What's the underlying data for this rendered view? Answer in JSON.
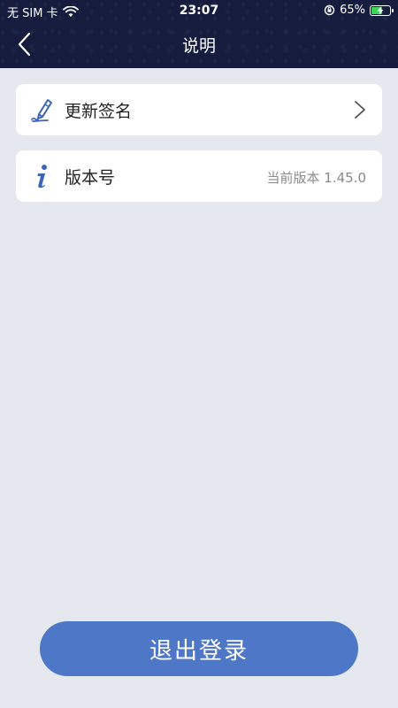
{
  "status_bar": {
    "carrier": "无 SIM 卡",
    "time": "23:07",
    "battery_percent": "65%",
    "battery_level": 0.65
  },
  "nav": {
    "title": "说明"
  },
  "items": [
    {
      "label": "更新签名",
      "icon": "signature-pen-icon",
      "has_chevron": true
    },
    {
      "label": "版本号",
      "icon": "info-icon",
      "value": "当前版本 1.45.0"
    }
  ],
  "logout": {
    "label": "退出登录"
  },
  "colors": {
    "header_bg": "#151c3d",
    "page_bg": "#e5e8ee",
    "accent": "#4f77c7",
    "icon_blue": "#3e64b8"
  }
}
